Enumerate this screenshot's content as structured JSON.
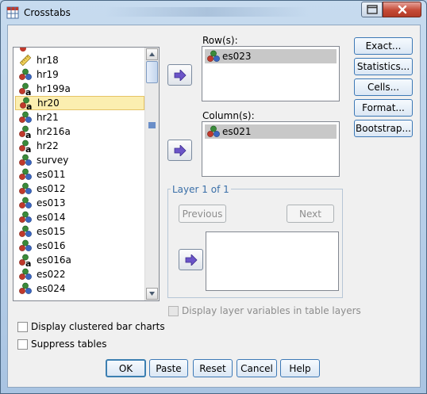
{
  "window": {
    "title": "Crosstabs"
  },
  "variables": [
    {
      "name": "hr18",
      "type": "ruler"
    },
    {
      "name": "hr19",
      "type": "nominal"
    },
    {
      "name": "hr199a",
      "type": "nominal-string"
    },
    {
      "name": "hr20",
      "type": "nominal-string",
      "selected": true
    },
    {
      "name": "hr21",
      "type": "nominal"
    },
    {
      "name": "hr216a",
      "type": "nominal-string"
    },
    {
      "name": "hr22",
      "type": "nominal-string"
    },
    {
      "name": "survey",
      "type": "nominal"
    },
    {
      "name": "es011",
      "type": "nominal"
    },
    {
      "name": "es012",
      "type": "nominal"
    },
    {
      "name": "es013",
      "type": "nominal"
    },
    {
      "name": "es014",
      "type": "nominal"
    },
    {
      "name": "es015",
      "type": "nominal"
    },
    {
      "name": "es016",
      "type": "nominal"
    },
    {
      "name": "es016a",
      "type": "nominal-string"
    },
    {
      "name": "es022",
      "type": "nominal"
    },
    {
      "name": "es024",
      "type": "nominal"
    }
  ],
  "rows": {
    "label": "Row(s):",
    "item": "es023"
  },
  "columns": {
    "label": "Column(s):",
    "item": "es021"
  },
  "layer": {
    "title": "Layer 1 of 1",
    "previous": "Previous",
    "next": "Next"
  },
  "side_buttons": {
    "exact": "Exact...",
    "statistics": "Statistics...",
    "cells": "Cells...",
    "format": "Format...",
    "bootstrap": "Bootstrap..."
  },
  "options": {
    "display_layer": "Display layer variables in table layers",
    "clustered_bar": "Display clustered bar charts",
    "suppress_tables": "Suppress tables"
  },
  "bottom_buttons": {
    "ok": "OK",
    "paste": "Paste",
    "reset": "Reset",
    "cancel": "Cancel",
    "help": "Help"
  },
  "colors": {
    "accent": "#3d79b6",
    "selection": "#fbeeb0",
    "close": "#c54a36"
  }
}
